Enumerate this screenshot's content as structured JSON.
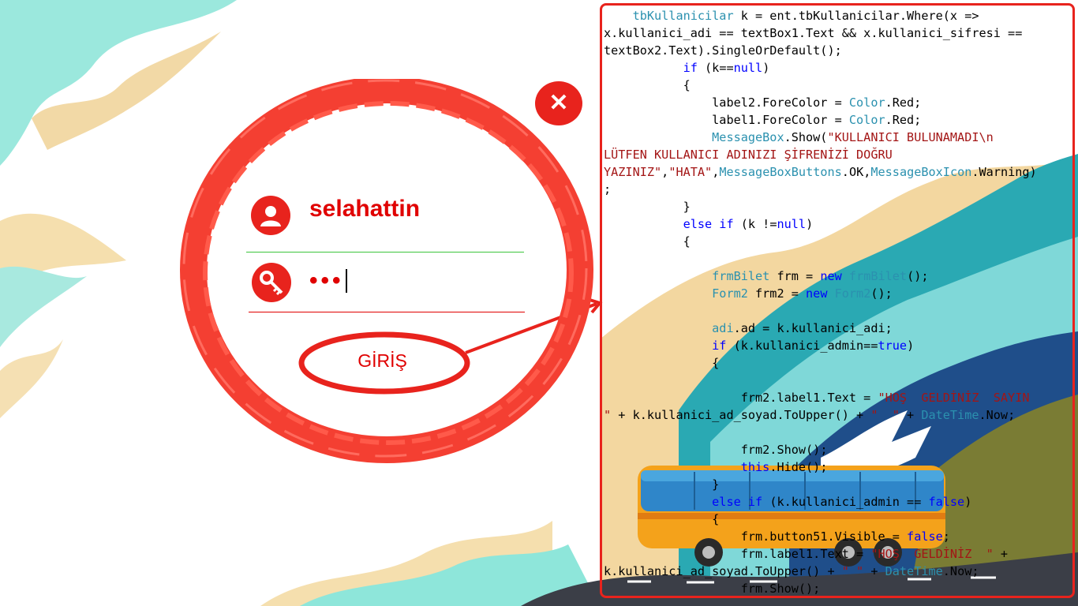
{
  "login": {
    "username_value": "selahattin",
    "password_mask": "•••",
    "login_label": "GİRİŞ",
    "close_label": "✕"
  },
  "icons": {
    "user": "user-icon",
    "key": "key-icon",
    "close": "close-icon"
  },
  "colors": {
    "accent_red": "#e8231d",
    "underline_green": "#3cc43c",
    "keyword_blue": "#0000ff",
    "type_teal": "#2b91af",
    "string_red": "#a31515"
  },
  "code_tokens": [
    "tbKullanicilar",
    " k = ent.tbKullanicilar.Where(x =>",
    "x.kullanici_adi == textBox1.Text && x.kullanici_sifresi ==",
    "textBox2.Text).SingleOrDefault();",
    "if",
    " (k==",
    "null",
    ")",
    "{",
    "label2.ForeColor = ",
    "Color",
    ".Red;",
    "label1.ForeColor = ",
    "Color",
    ".Red;",
    "MessageBox",
    ".Show(",
    "\"KULLANICI BULUNAMADI\\n",
    "LÜTFEN KULLANICI ADINIZI ŞİFRENİZİ DOĞRU",
    "YAZINIZ\"",
    ",",
    "\"HATA\"",
    ",",
    "MessageBoxButtons",
    ".OK,",
    "MessageBoxIcon",
    ".Warning)",
    ";",
    "}",
    "else if",
    " (k !=",
    "null",
    ")",
    "{",
    "frmBilet",
    " frm = ",
    "new",
    " ",
    "frmBilet",
    "();",
    "Form2",
    " frm2 = ",
    "new",
    " ",
    "Form2",
    "();",
    "adi",
    ".ad = k.kullanici_adi;",
    "if",
    " (k.kullanici_admin==",
    "true",
    ")",
    "{",
    "frm2.label1.Text = ",
    "\"HOŞ  GELDİNİZ  SAYIN",
    "\"",
    " + k.kullanici_ad_soyad.ToUpper() + ",
    "\"  \"",
    " + ",
    "DateTime",
    ".Now;",
    "frm2.Show();",
    "this",
    ".Hide();",
    "}",
    "else if",
    " (k.kullanici_admin == ",
    "false",
    ")",
    "{",
    "frm.button51.Visible = ",
    "false",
    ";",
    "frm.label1.Text = ",
    "\"HOŞ  GELDİNİZ  \"",
    " +",
    "k.kullanici_ad_soyad.ToUpper() + ",
    "\" \"",
    " + ",
    "DateTime",
    ".Now;",
    "frm.Show();"
  ]
}
